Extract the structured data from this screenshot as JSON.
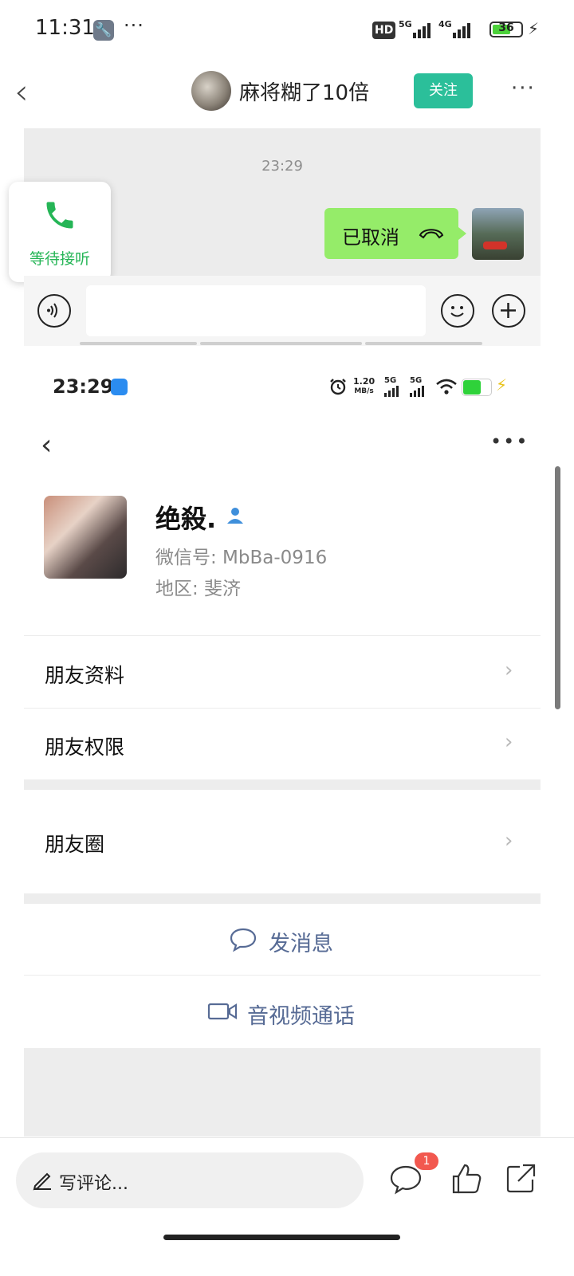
{
  "status_bar": {
    "time": "11:31",
    "dots": "···",
    "hd": "HD",
    "net1": "5G",
    "net2": "4G",
    "battery": "36"
  },
  "nav": {
    "title": "麻将糊了10倍",
    "follow_label": "关注",
    "more": "···"
  },
  "chat": {
    "time": "23:29",
    "call_status": "等待接听",
    "bubble_text": "已取消"
  },
  "inner_status": {
    "time": "23:29",
    "speed_value": "1.20",
    "speed_unit": "MB/s",
    "net1": "5G",
    "net2": "5G"
  },
  "profile": {
    "name": "绝殺.",
    "wechat_id": "微信号: MbBa-0916",
    "region": "地区: 斐济",
    "rows": [
      {
        "label": "朋友资料"
      },
      {
        "label": "朋友权限"
      },
      {
        "label": "朋友圈"
      }
    ],
    "send_message": "发消息",
    "video_call": "音视频通话"
  },
  "bottom": {
    "comment_placeholder": "写评论...",
    "comment_badge": "1"
  },
  "colors": {
    "follow": "#2bbf9a",
    "call_green": "#25b556",
    "bubble": "#95ec69",
    "link_blue": "#576b95",
    "badge_red": "#f2584f"
  }
}
